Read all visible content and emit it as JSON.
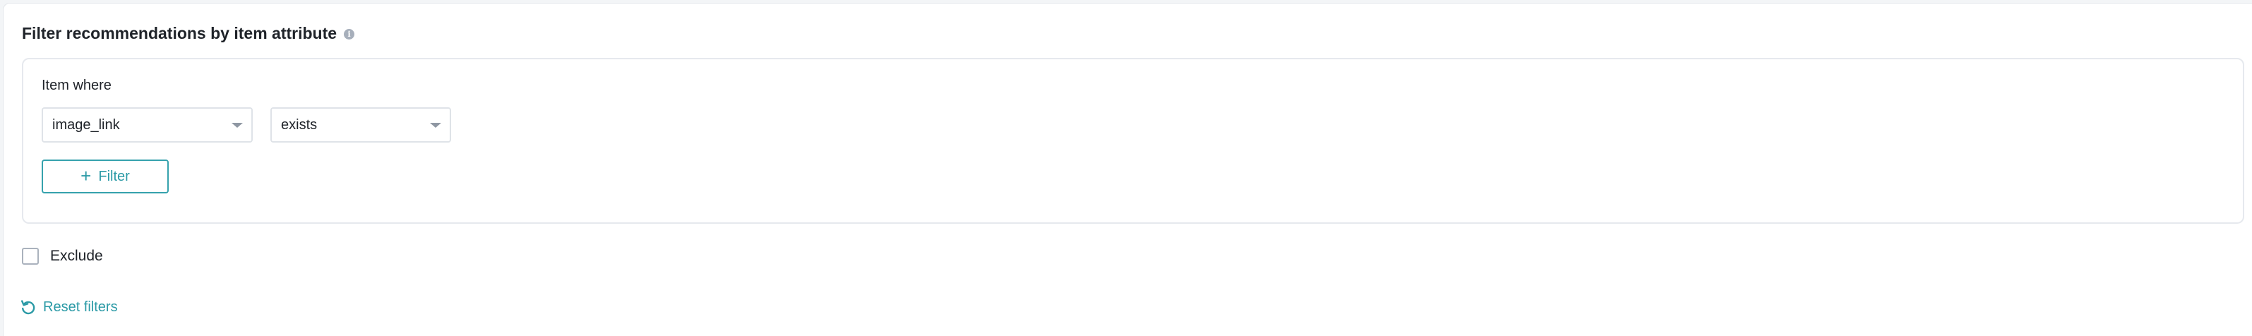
{
  "section": {
    "title": "Filter recommendations by item attribute",
    "info_icon": "info-icon"
  },
  "condition": {
    "label": "Item where",
    "attribute_select": {
      "value": "image_link",
      "icon": "chevron-down-icon"
    },
    "operator_select": {
      "value": "exists",
      "icon": "chevron-down-icon"
    },
    "add_filter_button": {
      "label": "Filter",
      "icon": "plus-icon"
    }
  },
  "exclude": {
    "label": "Exclude",
    "checked": false
  },
  "reset": {
    "label": "Reset filters",
    "icon": "reset-icon"
  },
  "colors": {
    "accent": "#2b9aa6",
    "border": "#e6e9ee",
    "text": "#1f2329",
    "muted_icon": "#a7afbb"
  }
}
